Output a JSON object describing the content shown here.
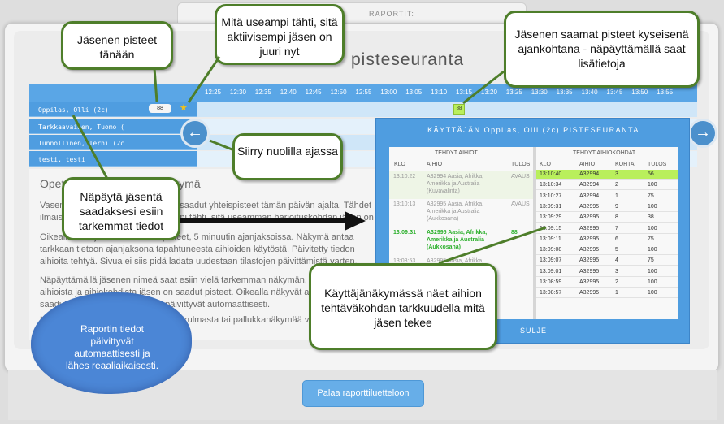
{
  "top_tab_label": "RAPORTIT:",
  "page_title": "pisteseuranta",
  "timeline": {
    "times": [
      "12:25",
      "12:30",
      "12:35",
      "12:40",
      "12:45",
      "12:50",
      "12:55",
      "13:00",
      "13:05",
      "13:10",
      "13:15",
      "13:20",
      "13:25",
      "13:30",
      "13:35",
      "13:40",
      "13:45",
      "13:50",
      "13:55"
    ],
    "members": [
      "Oppilas, Olli (2c)",
      "Tarkkaavainen, Tuomo (",
      "Tunnollinen, Terhi (2c",
      "testi, testi"
    ],
    "score_today": "88",
    "cell_score": "88"
  },
  "info": {
    "title": "Opettajan pisteseurantanäkymä",
    "para1": "Vasemmalla näet jäsenet, aihioista saadut yhteispisteet tämän päivän ajalta. Tähdet ilmaisevat aktiivisuutta: mitä useampi tähti, sitä useamman harjoituskohdan jäsen on juuri nyt",
    "para2": "Oikealla näet jäsenten saamat pisteet, 5 minuutin ajanjaksoissa. Näkymä antaa tarkkaan tietoon ajanjaksona tapahtuneesta aihioiden käytöstä. Päivitetty tiedon aihioita tehtyä. Sivua ei siis pidä ladata uudestaan tilastojen päivittämistä varten.",
    "para3": "Näpäyttämällä jäsenen nimeä saat esiin vielä tarkemman näkymän, josta näet mistä aihioista ja aihiokohdista jäsen on saadut pisteet. Oikealla näkyvät aihion eri kohdista saadut pisteet. Näkymän tiedot päivittyvät automaattisesti.",
    "para4": "Näkymän saat suljettua oikeasta alakulmasta tai pallukkanäkymää vasemmasta"
  },
  "modal": {
    "title": "KÄYTTÄJÄN Oppilas, Olli (2c) PISTESEURANTA",
    "left_heading": "TEHDYT AIHIOT",
    "right_heading": "TEHDYT AIHIOKOHDAT",
    "left_cols": [
      "KLO",
      "AIHIO",
      "TULOS"
    ],
    "right_cols": [
      "KLO",
      "AIHIO",
      "KOHTA",
      "TULOS"
    ],
    "left_rows": [
      {
        "klo": "13:10:22",
        "aihio": "A32994 Aasia, Afrikka, Amerikka ja Australia (Kuvavalinta)",
        "tulos": "AVAUS"
      },
      {
        "klo": "13:10:13",
        "aihio": "A32995 Aasia, Afrikka, Amerikka ja Australia (Aukkosana)",
        "tulos": "AVAUS"
      },
      {
        "klo": "13:09:31",
        "aihio": "A32995 Aasia, Afrikka, Amerikka ja Australia (Aukkosana)",
        "tulos": "88"
      },
      {
        "klo": "13:08:53",
        "aihio": "A32995 Aasia, Afrikka,",
        "tulos": ""
      }
    ],
    "right_rows": [
      {
        "klo": "13:10:40",
        "aihio": "A32994",
        "kohta": "3",
        "tulos": "56"
      },
      {
        "klo": "13:10:34",
        "aihio": "A32994",
        "kohta": "2",
        "tulos": "100"
      },
      {
        "klo": "13:10:27",
        "aihio": "A32994",
        "kohta": "1",
        "tulos": "75"
      },
      {
        "klo": "13:09:31",
        "aihio": "A32995",
        "kohta": "9",
        "tulos": "100"
      },
      {
        "klo": "13:09:29",
        "aihio": "A32995",
        "kohta": "8",
        "tulos": "38"
      },
      {
        "klo": "13:09:15",
        "aihio": "A32995",
        "kohta": "7",
        "tulos": "100"
      },
      {
        "klo": "13:09:11",
        "aihio": "A32995",
        "kohta": "6",
        "tulos": "75"
      },
      {
        "klo": "13:09:08",
        "aihio": "A32995",
        "kohta": "5",
        "tulos": "100"
      },
      {
        "klo": "13:09:07",
        "aihio": "A32995",
        "kohta": "4",
        "tulos": "75"
      },
      {
        "klo": "13:09:01",
        "aihio": "A32995",
        "kohta": "3",
        "tulos": "100"
      },
      {
        "klo": "13:08:59",
        "aihio": "A32995",
        "kohta": "2",
        "tulos": "100"
      },
      {
        "klo": "13:08:57",
        "aihio": "A32995",
        "kohta": "1",
        "tulos": "100"
      }
    ],
    "close_label": "SULJE"
  },
  "back_button": "Palaa raporttiluetteloon",
  "callouts": {
    "member_points": "Jäsenen pisteet tänään",
    "stars": "Mitä useampi tähti, sitä aktiivisempi jäsen on juuri nyt",
    "period_points": "Jäsenen saamat pisteet kyseisenä ajankohtana - näpäyttämällä saat lisätietoja",
    "arrows": "Siirry nuolilla ajassa",
    "tap_member": "Näpäytä jäsentä saadaksesi esiin tarkemmat tiedot",
    "user_view": "Käyttäjänäkymässä näet aihion tehtäväkohdan tarkkuudella mitä jäsen tekee",
    "cloud": "Raportin tiedot päivittyvät automaattisesti ja lähes reaaliaikaisesti."
  },
  "colors": {
    "primary_blue": "#4f9de0",
    "highlight_green": "#b9ef5c",
    "callout_border": "#4e7e2a",
    "cloud_blue": "#4b86d6"
  }
}
